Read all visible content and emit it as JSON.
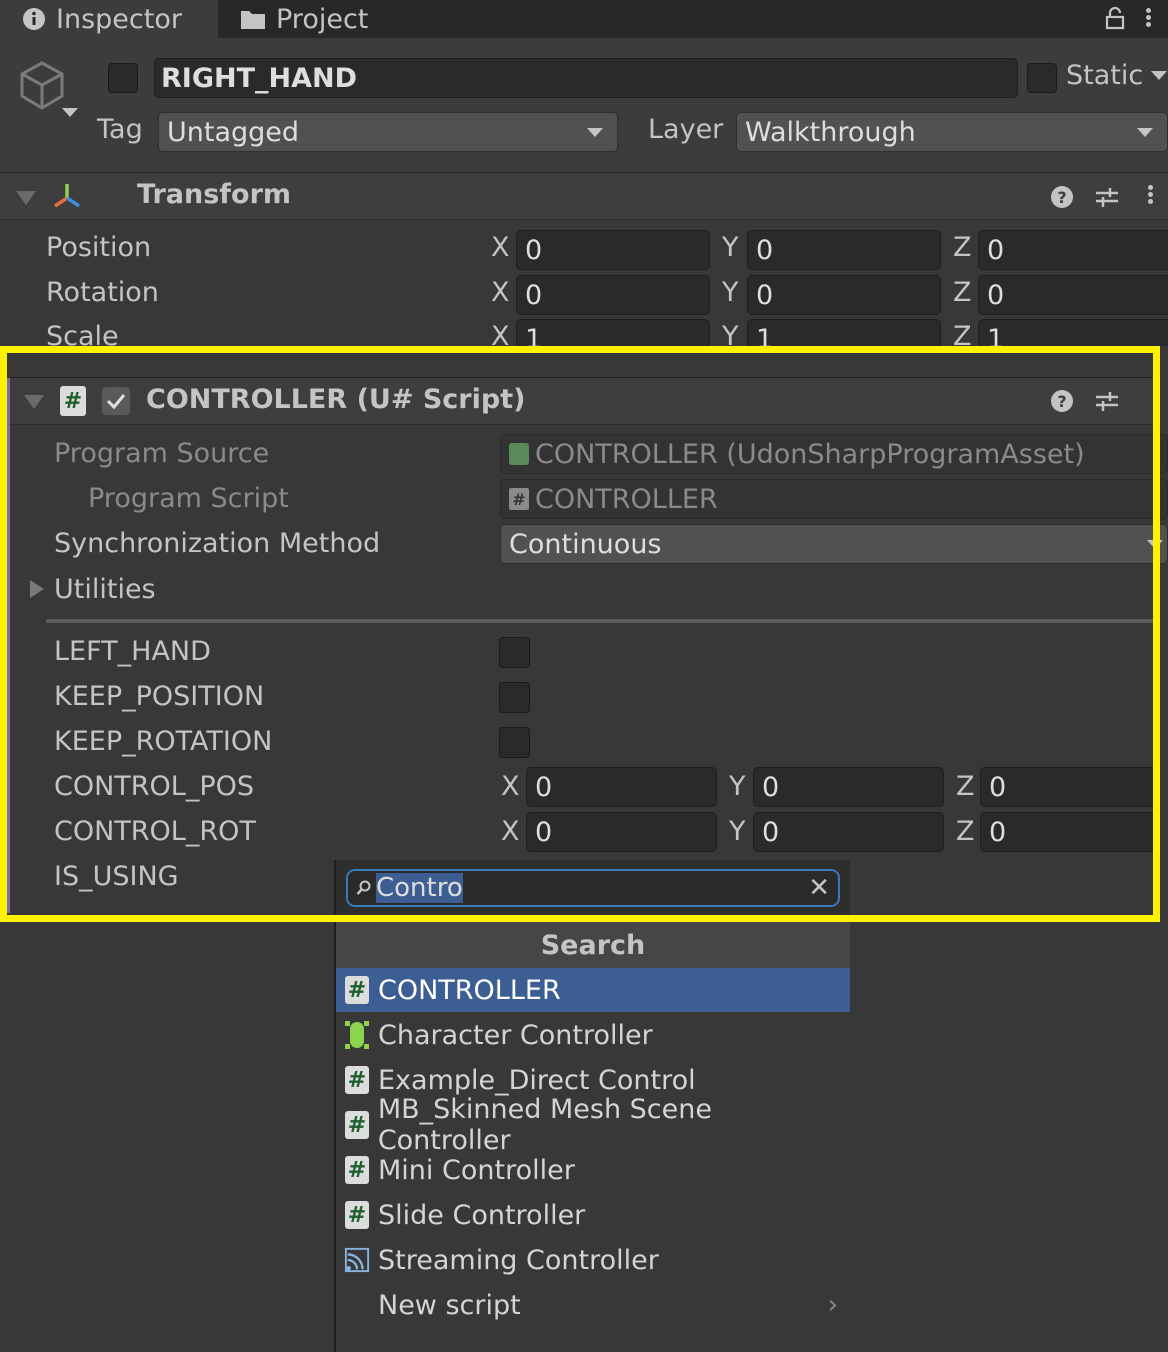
{
  "tabs": [
    {
      "label": "Inspector",
      "icon": "info-icon"
    },
    {
      "label": "Project",
      "icon": "folder-icon"
    }
  ],
  "object": {
    "name": "RIGHT_HAND",
    "static_label": "Static",
    "tag_label": "Tag",
    "tag_value": "Untagged",
    "layer_label": "Layer",
    "layer_value": "Walkthrough"
  },
  "transform": {
    "title": "Transform",
    "rows": [
      {
        "label": "Position",
        "x": "0",
        "y": "0",
        "z": "0"
      },
      {
        "label": "Rotation",
        "x": "0",
        "y": "0",
        "z": "0"
      },
      {
        "label": "Scale",
        "x": "1",
        "y": "1",
        "z": "1"
      }
    ]
  },
  "axes": {
    "x": "X",
    "y": "Y",
    "z": "Z"
  },
  "script": {
    "title": "CONTROLLER (U# Script)",
    "program_source_label": "Program Source",
    "program_source_value": "CONTROLLER (UdonSharpProgramAsset)",
    "program_script_label": "Program Script",
    "program_script_value": "CONTROLLER",
    "sync_label": "Synchronization Method",
    "sync_value": "Continuous",
    "utilities_label": "Utilities",
    "bools": [
      {
        "label": "LEFT_HAND",
        "checked": false
      },
      {
        "label": "KEEP_POSITION",
        "checked": false
      },
      {
        "label": "KEEP_ROTATION",
        "checked": false
      }
    ],
    "vectors": [
      {
        "label": "CONTROL_POS",
        "x": "0",
        "y": "0",
        "z": "0"
      },
      {
        "label": "CONTROL_ROT",
        "x": "0",
        "y": "0",
        "z": "0"
      }
    ],
    "is_using_label": "IS_USING"
  },
  "popup": {
    "search_value": "Contro",
    "header": "Search",
    "items": [
      {
        "label": "CONTROLLER",
        "icon": "csharp-script-icon",
        "selected": true
      },
      {
        "label": "Character Controller",
        "icon": "character-controller-icon",
        "selected": false
      },
      {
        "label": "Example_Direct Control",
        "icon": "csharp-script-icon",
        "selected": false
      },
      {
        "label": "MB_Skinned Mesh Scene Controller",
        "icon": "csharp-script-icon",
        "selected": false
      },
      {
        "label": "Mini Controller",
        "icon": "csharp-script-icon",
        "selected": false
      },
      {
        "label": "Slide Controller",
        "icon": "csharp-script-icon",
        "selected": false
      },
      {
        "label": "Streaming Controller",
        "icon": "streaming-controller-icon",
        "selected": false
      },
      {
        "label": "New script",
        "icon": "",
        "selected": false
      }
    ]
  },
  "colors": {
    "highlight": "#fff200",
    "selection": "#3d5e92",
    "script_accent": "#7c6fb0"
  }
}
